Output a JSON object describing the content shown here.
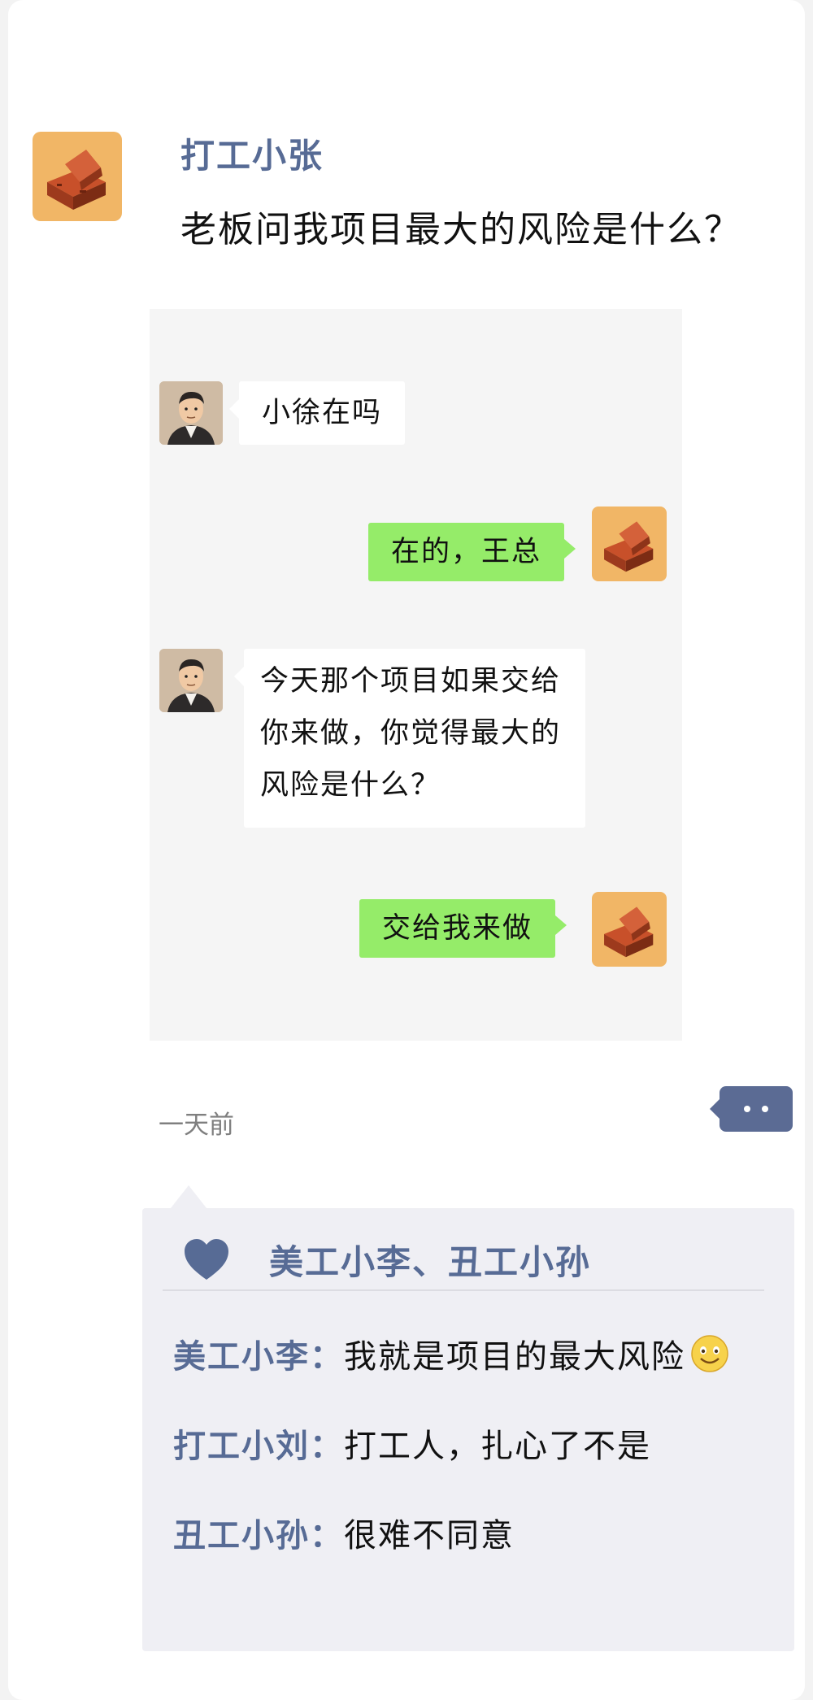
{
  "post": {
    "author": "打工小张",
    "text": "老板问我项目最大的风险是什么？",
    "time": "一天前",
    "author_avatar_icon": "brick-icon"
  },
  "chat": {
    "messages": [
      {
        "side": "left",
        "avatar": "man-avatar",
        "text": "小徐在吗"
      },
      {
        "side": "right",
        "avatar": "brick-avatar",
        "text": "在的，王总"
      },
      {
        "side": "left",
        "avatar": "man-avatar",
        "lines": [
          "今天那个项目如果交给",
          "你来做，你觉得最大的",
          "风险是什么？"
        ]
      },
      {
        "side": "right",
        "avatar": "brick-avatar",
        "text": "交给我来做"
      }
    ],
    "colors": {
      "self_bubble": "#95ec69",
      "other_bubble": "#ffffff",
      "background": "#f5f5f5"
    }
  },
  "likes": {
    "icon": "heart-icon",
    "names": "美工小李、丑工小孙"
  },
  "comments": [
    {
      "author": "美工小李：",
      "text": "我就是项目的最大风险",
      "emoji": "smile-emoji"
    },
    {
      "author": "打工小刘：",
      "text": "打工人，扎心了不是"
    },
    {
      "author": "丑工小孙：",
      "text": "很难不同意"
    }
  ],
  "theme": {
    "link_color": "#576b95",
    "more_button_color": "#5b6b94"
  }
}
